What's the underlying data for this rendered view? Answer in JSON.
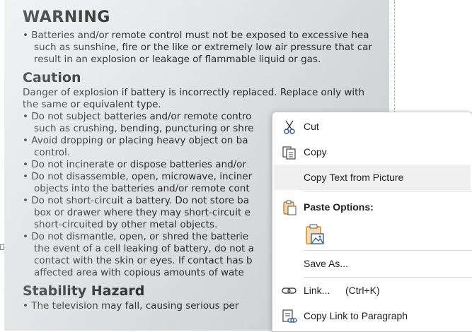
{
  "document": {
    "warning_heading": "WARNING",
    "warning_lines": [
      "• Batteries and/or remote control must not be exposed to excessive hea",
      "such as sunshine, fire or the like or extremely low air pressure that car",
      "result in an explosion or leakage of flammable liquid or gas."
    ],
    "caution_heading": "Caution",
    "caution_intro": [
      "Danger of explosion if battery is incorrectly replaced. Replace only with",
      "the same or equivalent type."
    ],
    "caution_lines": [
      "• Do not subject batteries and/or remote contro",
      "such as crushing, bending, puncturing or shre",
      "• Avoid dropping or placing heavy object on ba",
      "control.",
      "• Do not incinerate or dispose batteries and/or",
      "• Do not disassemble, open, microwave, inciner",
      "objects into the batteries and/or remote cont",
      "• Do not short-circuit a battery. Do not store ba",
      "box or drawer where they may short-circuit e",
      "short-circuited by other metal objects.",
      "• Do not dismantle, open, or shred the batterie",
      "the event of a cell leaking of battery, do not a",
      "contact with the skin or eyes. If contact has b",
      "affected area with copious amounts of wate"
    ],
    "stability_heading": "Stability Hazard",
    "stability_partial": "• The television may fall, causing serious per"
  },
  "context_menu": {
    "cut": {
      "label": "Cut",
      "icon": "scissors-icon"
    },
    "copy": {
      "label": "Copy",
      "icon": "copy-icon"
    },
    "copy_text_from_picture": {
      "label": "Copy Text from Picture"
    },
    "paste_options": {
      "label": "Paste Options:",
      "icon": "clipboard-icon"
    },
    "paste_picture": {
      "icon": "paste-picture-icon"
    },
    "save_as": {
      "label": "Save As..."
    },
    "link": {
      "label": "Link...",
      "shortcut": "(Ctrl+K)",
      "icon": "link-icon"
    },
    "copy_link_to_paragraph": {
      "label": "Copy Link to Paragraph",
      "icon": "copy-link-icon"
    }
  },
  "colors": {
    "menu_highlight": "#f0f0f0",
    "icon_orange": "#d98a1c",
    "icon_blue": "#2b5797"
  }
}
